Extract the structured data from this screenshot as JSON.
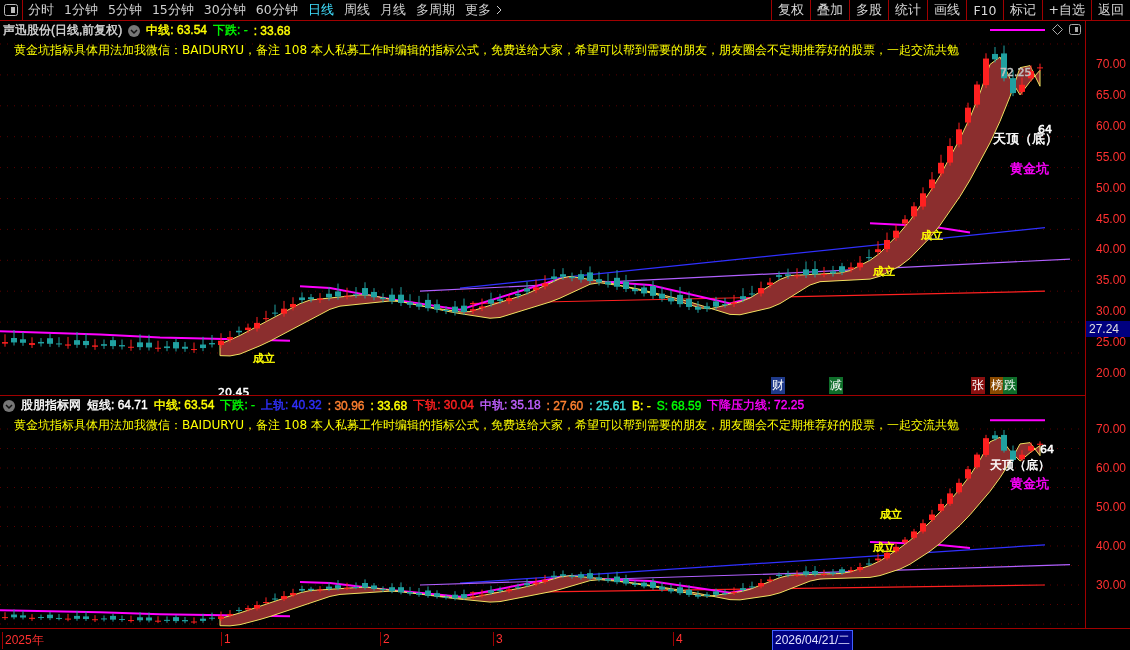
{
  "toolbar": {
    "periods": [
      {
        "label": "分时",
        "selected": false
      },
      {
        "label": "1分钟",
        "selected": false
      },
      {
        "label": "5分钟",
        "selected": false
      },
      {
        "label": "15分钟",
        "selected": false
      },
      {
        "label": "30分钟",
        "selected": false
      },
      {
        "label": "60分钟",
        "selected": false
      },
      {
        "label": "日线",
        "selected": true
      },
      {
        "label": "周线",
        "selected": false
      },
      {
        "label": "月线",
        "selected": false
      },
      {
        "label": "多周期",
        "selected": false
      },
      {
        "label": "更多",
        "selected": false
      }
    ],
    "actions": [
      "复权",
      "叠加",
      "多股",
      "统计",
      "画线",
      "F10",
      "标记",
      "+自选",
      "返回"
    ]
  },
  "upper_panel": {
    "title": "声迅股份(日线,前复权)",
    "readings": [
      {
        "text": "中线: 63.54",
        "color": "#ffff00"
      },
      {
        "text": "下跌: -",
        "color": "#00ff00"
      },
      {
        "text": " : 33.68",
        "color": "#ffff00"
      }
    ],
    "message": "黄金坑指标具体用法加我微信：BAIDURYU，备注 108 本人私募工作时编辑的指标公式，免费送给大家，希望可以帮到需要的朋友，朋友圈会不定期推荐好的股票，一起交流共勉",
    "annotations": [
      {
        "text": "72.25",
        "color": "#c0c0c0"
      },
      {
        "text": "64",
        "color": "#ffffff"
      },
      {
        "text": "天顶（底）",
        "color": "#ffffff"
      },
      {
        "text": "黄金坑",
        "color": "#ff00ff"
      },
      {
        "text": "成立",
        "color": "#ffff00"
      },
      {
        "text": "成立",
        "color": "#ffff00"
      },
      {
        "text": "成立",
        "color": "#ffff00"
      },
      {
        "text": "20.45",
        "color": "#ffffff"
      }
    ],
    "markers": [
      {
        "text": "财",
        "color": "#1f3a8a"
      },
      {
        "text": "减",
        "color": "#0f6e2a"
      },
      {
        "text": "张",
        "color": "#8a1010"
      },
      {
        "text": "榜",
        "color": "#8a4a00"
      },
      {
        "text": "跌",
        "color": "#0f6e2a"
      }
    ],
    "axis": {
      "labels": [
        "70.00",
        "65.00",
        "60.00",
        "55.00",
        "50.00",
        "45.00",
        "40.00",
        "35.00",
        "30.00",
        "25.00",
        "20.00"
      ],
      "current_price": "27.24"
    }
  },
  "lower_panel": {
    "readings": [
      {
        "text": "股朋指标网",
        "color": "#ffffff"
      },
      {
        "text": "短线: 64.71",
        "color": "#ffffff"
      },
      {
        "text": "中线: 63.54",
        "color": "#ffff00"
      },
      {
        "text": "下跌: -",
        "color": "#00ff00"
      },
      {
        "text": "上轨: 40.32",
        "color": "#3030ff"
      },
      {
        "text": ": 30.96",
        "color": "#ff8030"
      },
      {
        "text": ": 33.68",
        "color": "#ffff00"
      },
      {
        "text": "下轨: 30.04",
        "color": "#ff2020"
      },
      {
        "text": "中轨: 35.18",
        "color": "#c060ff"
      },
      {
        "text": ": 27.60",
        "color": "#ff8030"
      },
      {
        "text": ": 25.61",
        "color": "#40e0e0"
      },
      {
        "text": "B: -",
        "color": "#ffff00"
      },
      {
        "text": "S: 68.59",
        "color": "#00ff00"
      },
      {
        "text": "下降压力线: 72.25",
        "color": "#ff00ff"
      }
    ],
    "message": "黄金坑指标具体用法加我微信：BAIDURYU，备注 108 本人私募工作时编辑的指标公式，免费送给大家，希望可以帮到需要的朋友，朋友圈会不定期推荐好的股票，一起交流共勉",
    "annotations": [
      {
        "text": "64",
        "color": "#ffffff"
      },
      {
        "text": "天顶（底）",
        "color": "#ffffff"
      },
      {
        "text": "黄金坑",
        "color": "#ff00ff"
      },
      {
        "text": "成立",
        "color": "#ffff00"
      },
      {
        "text": "成立",
        "color": "#ffff00"
      }
    ],
    "axis": {
      "labels": [
        "70.00",
        "60.00",
        "50.00",
        "40.00",
        "30.00"
      ]
    }
  },
  "time_axis": {
    "labels": [
      "2025年",
      "1",
      "2",
      "3",
      "4"
    ],
    "cursor_date": "2026/04/21/二"
  }
}
